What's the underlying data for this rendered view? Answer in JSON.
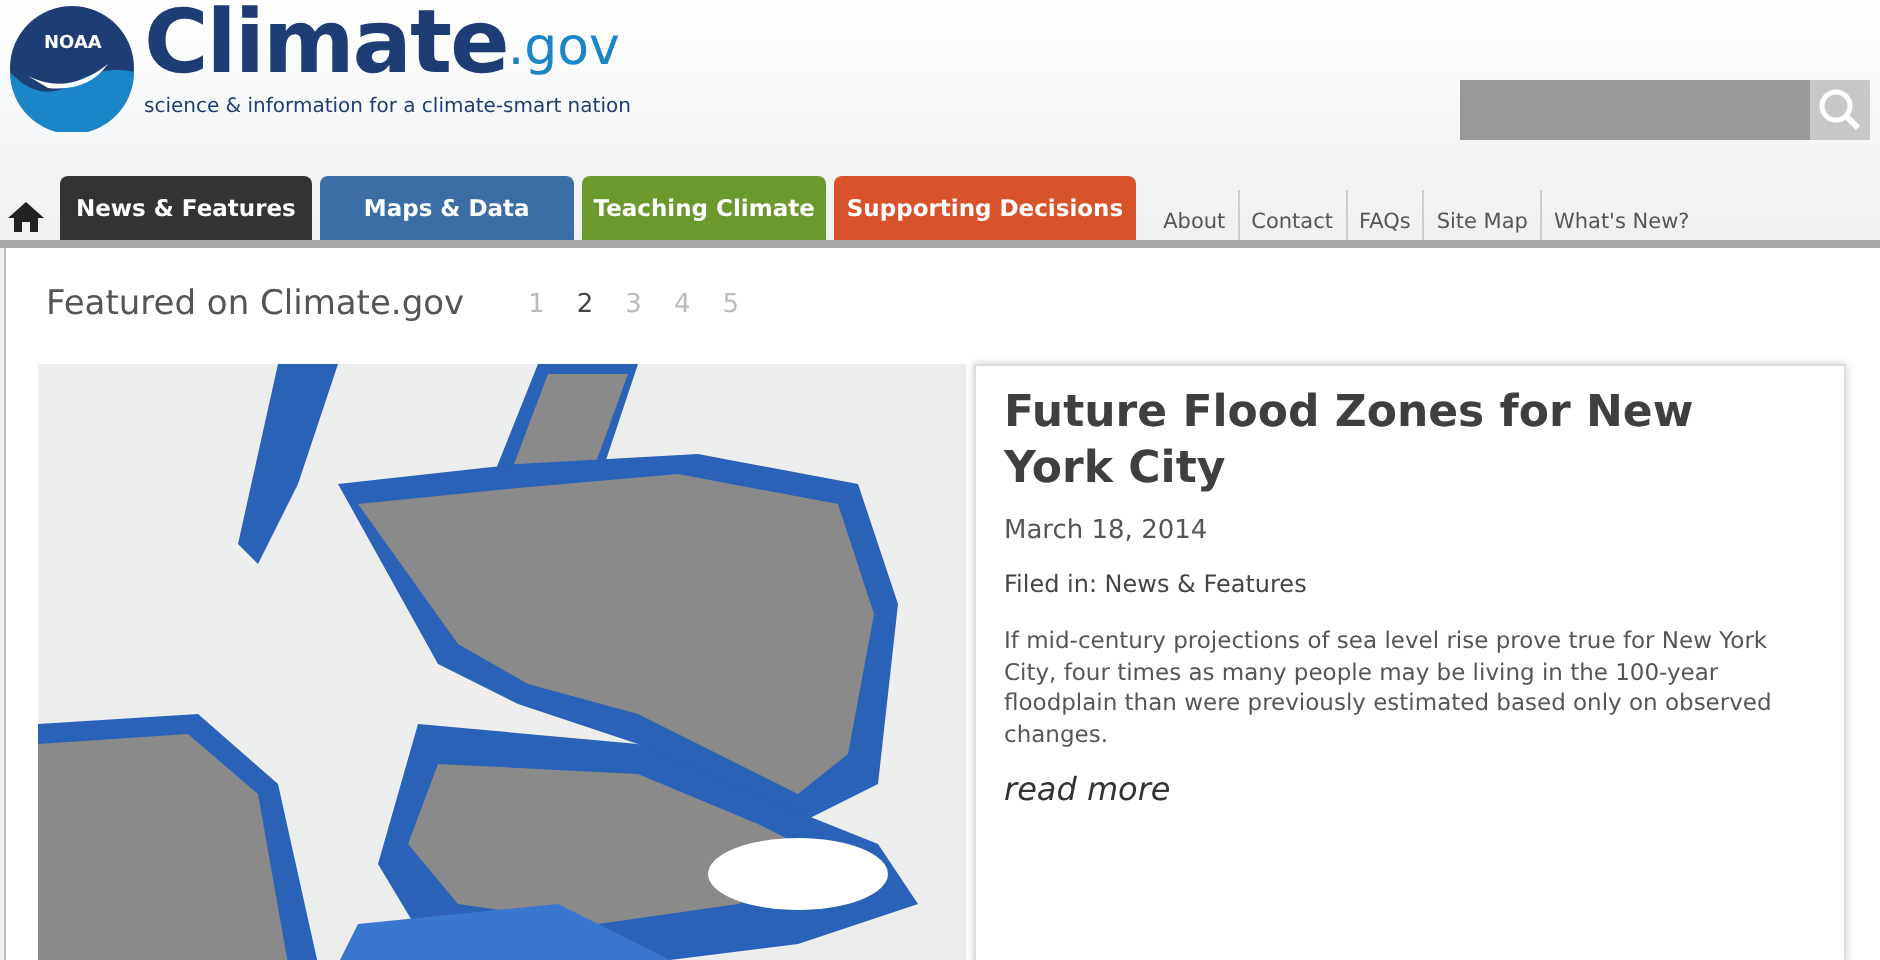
{
  "logo": {
    "badge": "NOAA",
    "name": "Climate",
    "suffix": ".gov",
    "tagline": "science & information for a climate-smart nation"
  },
  "main_tabs": [
    {
      "label": "News & Features",
      "color": "#333333"
    },
    {
      "label": "Maps & Data",
      "color": "#3a6ea5"
    },
    {
      "label": "Teaching Climate",
      "color": "#6a9a2e"
    },
    {
      "label": "Supporting Decisions",
      "color": "#d8532a"
    }
  ],
  "utility_links": [
    "About",
    "Contact",
    "FAQs",
    "Site Map",
    "What's New?"
  ],
  "featured": {
    "heading": "Featured on Climate.gov",
    "pages": [
      {
        "label": "1",
        "selected": false
      },
      {
        "label": "2",
        "selected": true
      },
      {
        "label": "3",
        "selected": false
      },
      {
        "label": "4",
        "selected": false
      },
      {
        "label": "5",
        "selected": false
      }
    ],
    "article": {
      "title": "Future Flood Zones for New York City",
      "date": "March 18, 2014",
      "filed": "Filed in: News & Features",
      "summary": "If mid-century projections of sea level rise prove true for New York City, four times as many people may be living in the 100-year floodplain than were previously estimated based only on observed changes.",
      "more": "read more"
    }
  }
}
